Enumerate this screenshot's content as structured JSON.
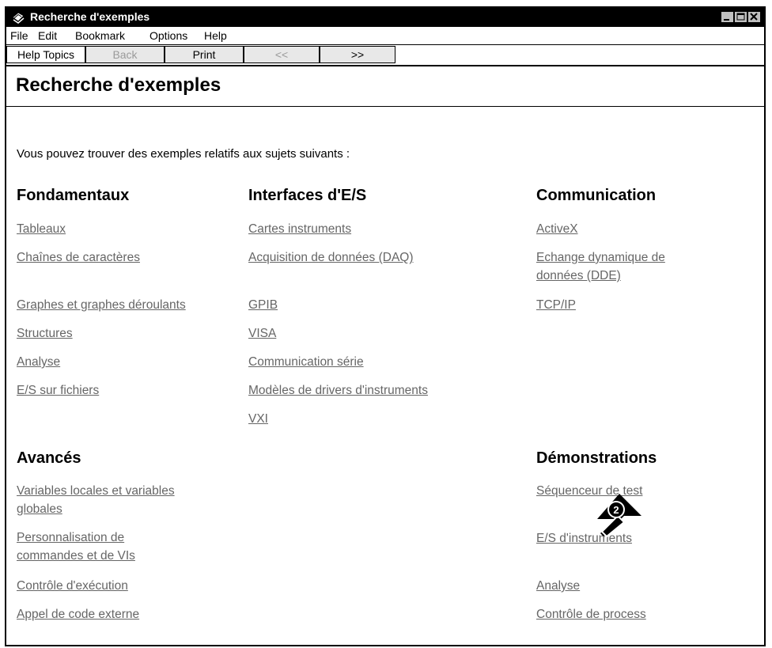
{
  "window": {
    "title": "Recherche d'exemples"
  },
  "menu": [
    "File",
    "Edit",
    "Bookmark",
    "Options",
    "Help"
  ],
  "toolbar": [
    "Help Topics",
    "Back",
    "Print",
    "<<",
    ">>"
  ],
  "page": {
    "title": "Recherche d'exemples",
    "intro": "Vous pouvez trouver des exemples relatifs aux sujets suivants :"
  },
  "sections": {
    "fondamentaux": {
      "heading": "Fondamentaux",
      "links": [
        "Tableaux",
        "Chaînes de caractères",
        "Graphes et graphes déroulants",
        "Structures",
        "Analyse",
        "E/S sur fichiers"
      ]
    },
    "interfaces": {
      "heading": "Interfaces d'E/S",
      "links": [
        "Cartes instruments",
        "Acquisition de données (DAQ)",
        "GPIB",
        "VISA",
        "Communication série",
        "Modèles de drivers d'instruments",
        "VXI"
      ]
    },
    "communication": {
      "heading": "Communication",
      "links": [
        "ActiveX",
        "Echange dynamique de",
        "données (DDE)",
        "TCP/IP"
      ]
    },
    "avances": {
      "heading": "Avancés",
      "links": [
        "Variables locales et variables",
        "globales",
        "Personnalisation de",
        "commandes et de VIs",
        "Contrôle d'exécution",
        "Appel de code externe"
      ]
    },
    "demonstrations": {
      "heading": "Démonstrations",
      "links": [
        "Séquenceur de test",
        "E/S d'instruments",
        "Analyse",
        "Contrôle de process"
      ]
    }
  },
  "badge": {
    "number": "2"
  },
  "icons": [
    "help-book-icon",
    "minimize-icon",
    "maximize-icon",
    "close-icon",
    "step-badge-icon"
  ]
}
